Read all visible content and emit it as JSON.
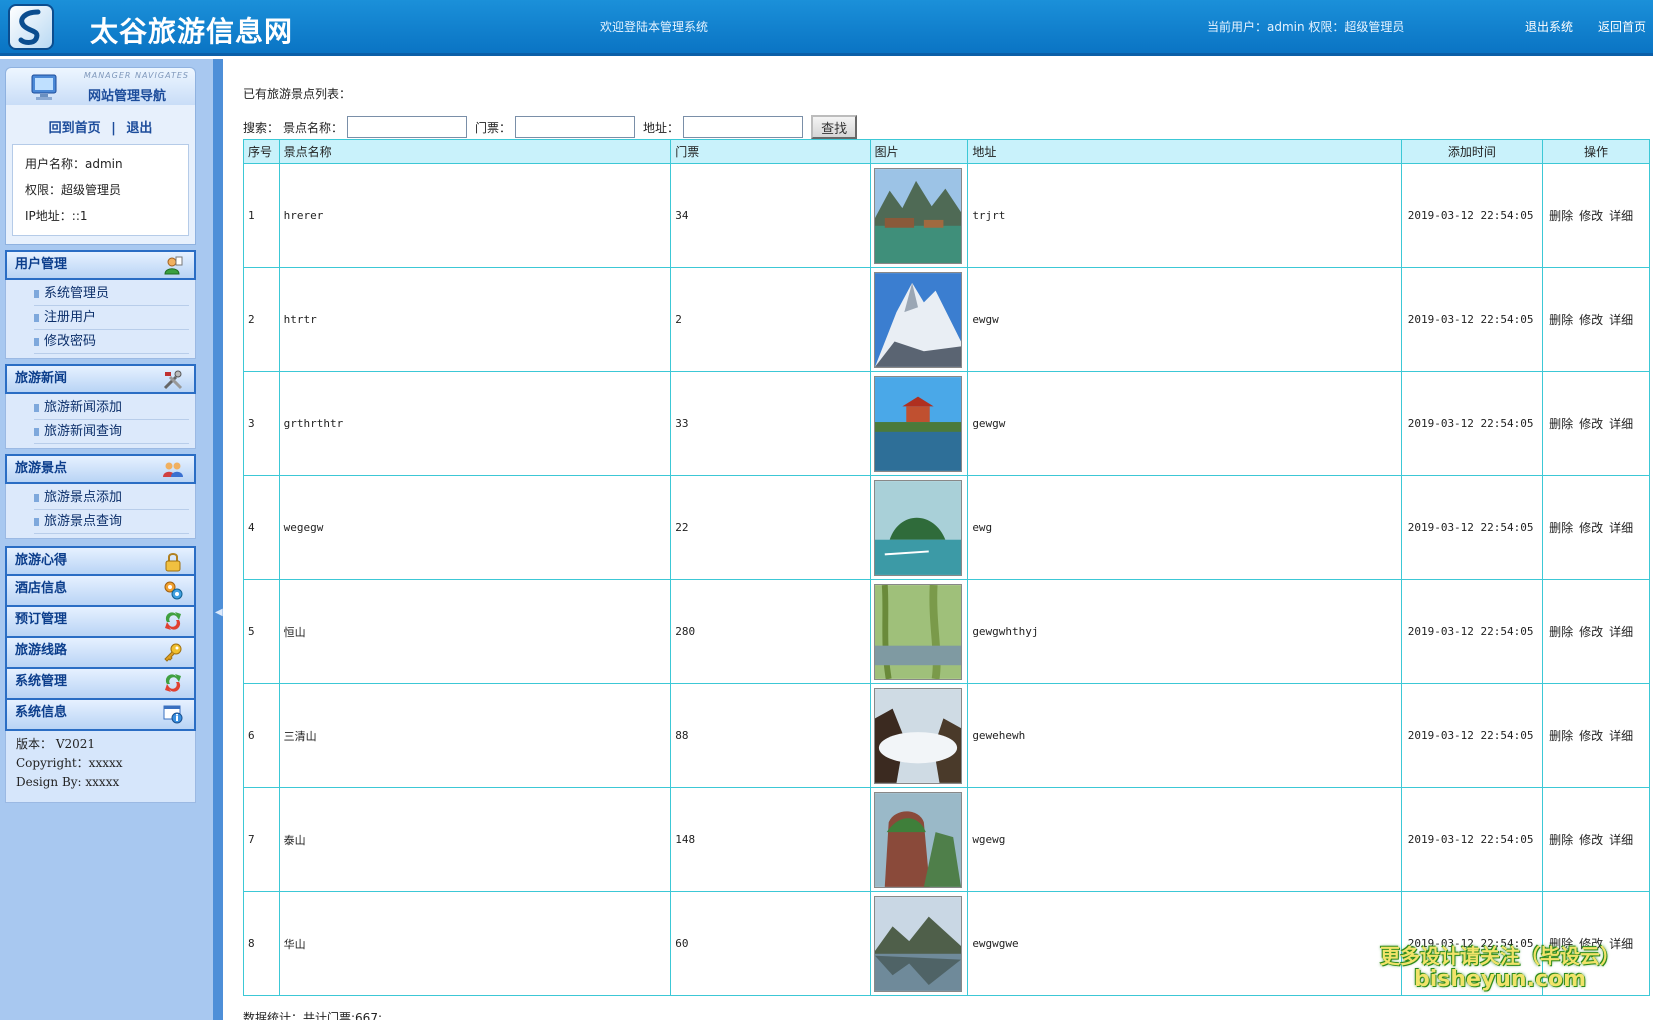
{
  "header": {
    "site_title": "太谷旅游信息网",
    "welcome": "欢迎登陆本管理系统",
    "user_info": "当前用户：admin 权限：超级管理员",
    "logout": "退出系统",
    "home": "返回首页"
  },
  "sidebar": {
    "banner_en": "MANAGER NAVIGATES",
    "banner_cn": "网站管理导航",
    "home_link": "回到首页",
    "separator": "|",
    "exit_link": "退出",
    "username": "用户名称：admin",
    "role": "权限：超级管理员",
    "ip": "IP地址：::1",
    "menus": [
      {
        "title": "用户管理",
        "items": [
          "系统管理员",
          "注册用户",
          "修改密码"
        ]
      },
      {
        "title": "旅游新闻",
        "items": [
          "旅游新闻添加",
          "旅游新闻查询"
        ]
      },
      {
        "title": "旅游景点",
        "items": [
          "旅游景点添加",
          "旅游景点查询"
        ]
      }
    ],
    "compact_menus": [
      "旅游心得",
      "酒店信息",
      "预订管理",
      "旅游线路",
      "系统管理",
      "系统信息"
    ],
    "sysinfo": [
      "版本： V2021",
      "Copyright：xxxxx",
      "Design By:  xxxxx"
    ]
  },
  "main": {
    "list_title": "已有旅游景点列表：",
    "search": {
      "prefix": "搜索：",
      "name_label": "景点名称：",
      "ticket_label": "门票：",
      "address_label": "地址：",
      "button": "查找"
    },
    "columns": [
      "序号",
      "景点名称",
      "门票",
      "图片",
      "地址",
      "添加时间",
      "操作"
    ],
    "actions": [
      "删除",
      "修改",
      "详细"
    ],
    "rows": [
      {
        "id": "1",
        "name": "hrerer",
        "ticket": "34",
        "address": "trjrt",
        "time": "2019-03-12 22:54:05",
        "scene": "lake-village"
      },
      {
        "id": "2",
        "name": "htrtr",
        "ticket": "2",
        "address": "ewgw",
        "time": "2019-03-12 22:54:05",
        "scene": "snow-peak"
      },
      {
        "id": "3",
        "name": "grthrthtr",
        "ticket": "33",
        "address": "gewgw",
        "time": "2019-03-12 22:54:05",
        "scene": "pavilion"
      },
      {
        "id": "4",
        "name": "wegegw",
        "ticket": "22",
        "address": "ewg",
        "time": "2019-03-12 22:54:05",
        "scene": "island"
      },
      {
        "id": "5",
        "name": "恒山",
        "ticket": "280",
        "address": "gewgwhthyj",
        "time": "2019-03-12 22:54:05",
        "scene": "willow-river"
      },
      {
        "id": "6",
        "name": "三清山",
        "ticket": "88",
        "address": "gewehewh",
        "time": "2019-03-12 22:54:05",
        "scene": "cloud-sea"
      },
      {
        "id": "7",
        "name": "泰山",
        "ticket": "148",
        "address": "wgewg",
        "time": "2019-03-12 22:54:05",
        "scene": "green-cliff"
      },
      {
        "id": "8",
        "name": "华山",
        "ticket": "60",
        "address": "ewgwgwe",
        "time": "2019-03-12 22:54:05",
        "scene": "mountain-lake"
      }
    ],
    "stats": "数据统计：共计门票:667;"
  },
  "watermark": {
    "line1": "更多设计请关注（毕设云）",
    "line2": "bisheyun.com"
  },
  "colors": {
    "header": "#0a74c4",
    "sidebar": "#a8c8f0",
    "grid_border": "#3cc8d6",
    "grid_header": "#c9f2fb"
  }
}
